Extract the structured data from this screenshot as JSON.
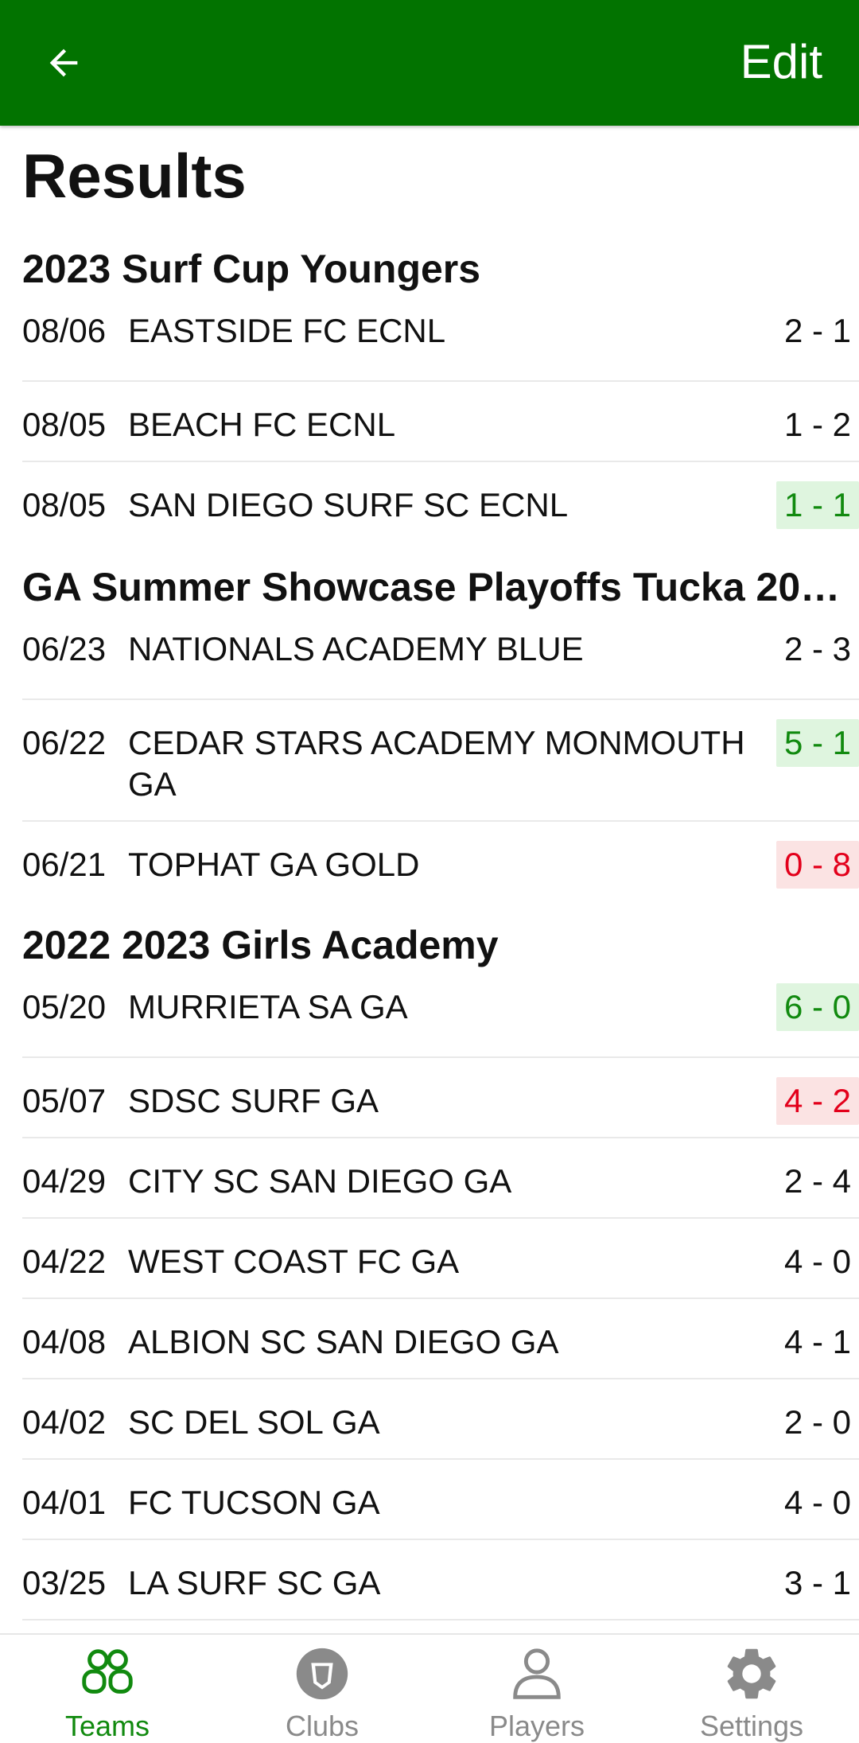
{
  "header": {
    "edit_label": "Edit",
    "back_icon": "arrow-left-icon",
    "bg_color": "#027300"
  },
  "page_title": "Results",
  "colors": {
    "win": "#118a0f",
    "win_bg": "#dff5df",
    "loss": "#e3001b",
    "loss_bg": "#fbe3e3",
    "active_tab": "#118a0f"
  },
  "sections": [
    {
      "title": "2023 Surf Cup Youngers",
      "matches": [
        {
          "date": "08/06",
          "opponent": "EASTSIDE FC ECNL",
          "score": "2 - 1",
          "status": "neutral"
        },
        {
          "date": "08/05",
          "opponent": "BEACH FC ECNL",
          "score": "1 - 2",
          "status": "neutral"
        },
        {
          "date": "08/05",
          "opponent": "SAN DIEGO SURF SC ECNL",
          "score": "1 - 1",
          "status": "win"
        }
      ]
    },
    {
      "title": "GA Summer Showcase Playoffs Tucka 20…",
      "matches": [
        {
          "date": "06/23",
          "opponent": "NATIONALS ACADEMY BLUE",
          "score": "2 - 3",
          "status": "neutral"
        },
        {
          "date": "06/22",
          "opponent": "CEDAR STARS ACADEMY MONMOUTH GA",
          "score": "5 - 1",
          "status": "win"
        },
        {
          "date": "06/21",
          "opponent": "TOPHAT GA GOLD",
          "score": "0 - 8",
          "status": "loss"
        }
      ]
    },
    {
      "title": "2022 2023 Girls Academy",
      "matches": [
        {
          "date": "05/20",
          "opponent": "MURRIETA SA GA",
          "score": "6 - 0",
          "status": "win"
        },
        {
          "date": "05/07",
          "opponent": "SDSC SURF GA",
          "score": "4 - 2",
          "status": "loss"
        },
        {
          "date": "04/29",
          "opponent": "CITY SC SAN DIEGO GA",
          "score": "2 - 4",
          "status": "neutral"
        },
        {
          "date": "04/22",
          "opponent": "WEST COAST FC GA",
          "score": "4 - 0",
          "status": "neutral"
        },
        {
          "date": "04/08",
          "opponent": "ALBION SC SAN DIEGO GA",
          "score": "4 - 1",
          "status": "neutral"
        },
        {
          "date": "04/02",
          "opponent": "SC DEL SOL GA",
          "score": "2 - 0",
          "status": "neutral"
        },
        {
          "date": "04/01",
          "opponent": "FC TUCSON GA",
          "score": "4 - 0",
          "status": "neutral"
        },
        {
          "date": "03/25",
          "opponent": "LA SURF SC GA",
          "score": "3 - 1",
          "status": "neutral"
        }
      ]
    }
  ],
  "tabs": [
    {
      "label": "Teams",
      "icon": "teams-icon",
      "active": true
    },
    {
      "label": "Clubs",
      "icon": "clubs-icon",
      "active": false
    },
    {
      "label": "Players",
      "icon": "players-icon",
      "active": false
    },
    {
      "label": "Settings",
      "icon": "settings-icon",
      "active": false
    }
  ]
}
